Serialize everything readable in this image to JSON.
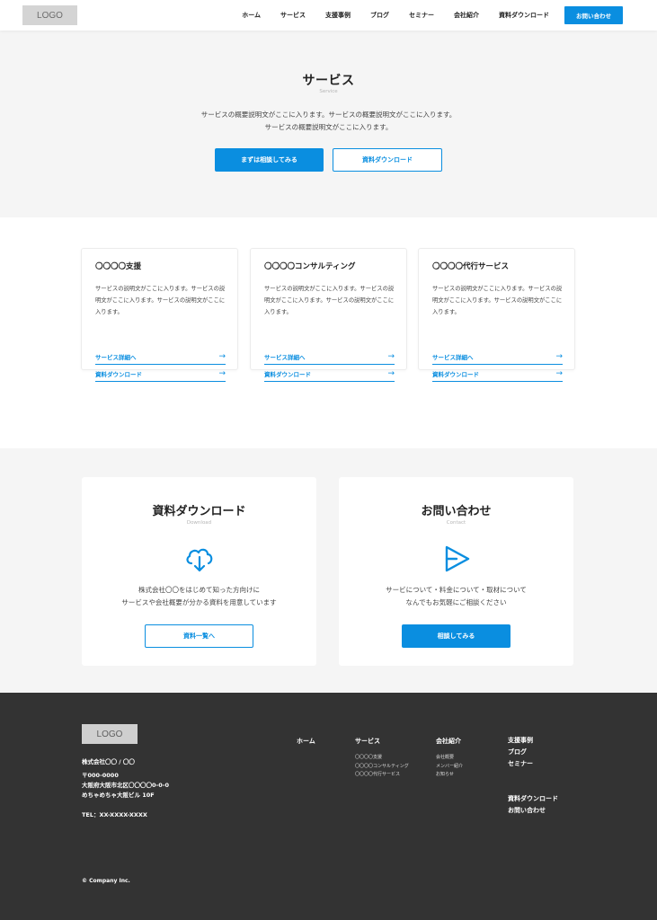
{
  "header": {
    "logo": "LOGO",
    "nav": [
      "ホーム",
      "サービス",
      "支援事例",
      "ブログ",
      "セミナー",
      "会社紹介",
      "資料ダウンロード"
    ],
    "cta": "お問い合わせ"
  },
  "hero": {
    "title": "サービス",
    "subtitle": "Service",
    "desc_line1": "サービスの概要説明文がここに入ります。サービスの概要説明文がここに入ります。",
    "desc_line2": "サービスの概要説明文がここに入ります。",
    "primary_button": "まずは相談してみる",
    "secondary_button": "資料ダウンロード"
  },
  "services": [
    {
      "title": "〇〇〇〇支援",
      "desc": "サービスの説明文がここに入ります。サービスの説明文がここに入ります。サービスの説明文がここに入ります。",
      "link1": "サービス詳細へ",
      "link2": "資料ダウンロード"
    },
    {
      "title": "〇〇〇〇コンサルティング",
      "desc": "サービスの説明文がここに入ります。サービスの説明文がここに入ります。サービスの説明文がここに入ります。",
      "link1": "サービス詳細へ",
      "link2": "資料ダウンロード"
    },
    {
      "title": "〇〇〇〇代行サービス",
      "desc": "サービスの説明文がここに入ります。サービスの説明文がここに入ります。サービスの説明文がここに入ります。",
      "link1": "サービス詳細へ",
      "link2": "資料ダウンロード"
    }
  ],
  "cta": {
    "download": {
      "title": "資料ダウンロード",
      "subtitle": "Download",
      "icon": "cloud-download-icon",
      "desc_line1": "株式会社〇〇をはじめて知った方向けに",
      "desc_line2": "サービスや会社概要が分かる資料を用意しています",
      "button": "資料一覧へ"
    },
    "contact": {
      "title": "お問い合わせ",
      "subtitle": "Contact",
      "icon": "send-icon",
      "desc_line1": "サービについて・料金について・取材について",
      "desc_line2": "なんでもお気軽にご相談ください",
      "button": "相談してみる"
    }
  },
  "footer": {
    "logo": "LOGO",
    "company": "株式会社〇〇 / 〇〇",
    "postal": "〒000-0000",
    "address1": "大阪府大阪市北区〇〇〇〇0-0-0",
    "address2": "めちゃめちゃ大阪ビル 10F",
    "tel": "TEL：XX-XXXX-XXXX",
    "copyright": "© Company Inc.",
    "col_home": "ホーム",
    "col_service": {
      "heading": "サービス",
      "items": [
        "〇〇〇〇支援",
        "〇〇〇〇コンサルティング",
        "〇〇〇〇代行サービス"
      ]
    },
    "col_company": {
      "heading": "会社紹介",
      "items": [
        "会社概要",
        "メンバー紹介",
        "お知らせ"
      ]
    },
    "col_links": [
      "支援事例",
      "ブログ",
      "セミナー"
    ],
    "col_links2": [
      "資料ダウンロード",
      "お問い合わせ"
    ]
  },
  "colors": {
    "accent": "#0a8ee0",
    "light_bg": "#f5f5f5",
    "footer_bg": "#333333"
  }
}
